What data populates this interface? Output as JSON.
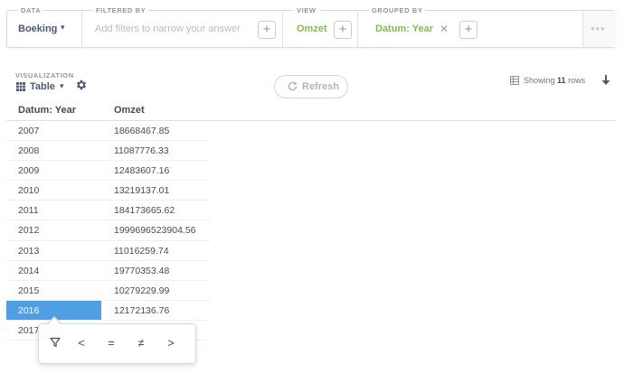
{
  "query_bar": {
    "data": {
      "label": "DATA",
      "value": "Boeking"
    },
    "filter": {
      "label": "FILTERED BY",
      "placeholder": "Add filters to narrow your answer"
    },
    "view": {
      "label": "VIEW",
      "value": "Omzet"
    },
    "grouped": {
      "label": "GROUPED BY",
      "value": "Datum: Year"
    },
    "accent_color": "#84bb4c"
  },
  "visualization": {
    "label": "VISUALIZATION",
    "type": "Table",
    "refresh_label": "Refresh",
    "rows_prefix": "Showing",
    "rows_count": "11",
    "rows_suffix": "rows"
  },
  "table": {
    "columns": [
      "Datum: Year",
      "Omzet"
    ],
    "rows": [
      [
        "2007",
        "18668467.85"
      ],
      [
        "2008",
        "11087776.33"
      ],
      [
        "2009",
        "12483607.16"
      ],
      [
        "2010",
        "13219137.01"
      ],
      [
        "2011",
        "184173665.62"
      ],
      [
        "2012",
        "1999696523904.56"
      ],
      [
        "2013",
        "11016259.74"
      ],
      [
        "2014",
        "19770353.48"
      ],
      [
        "2015",
        "10279229.99"
      ],
      [
        "2016",
        "12172136.76"
      ],
      [
        "2017",
        ""
      ]
    ],
    "selected_row": 9,
    "selected_color": "#509ee3"
  },
  "popover": {
    "filter_icon": "filter-icon",
    "lt": "<",
    "eq": "=",
    "ne": "≠",
    "gt": ">"
  }
}
